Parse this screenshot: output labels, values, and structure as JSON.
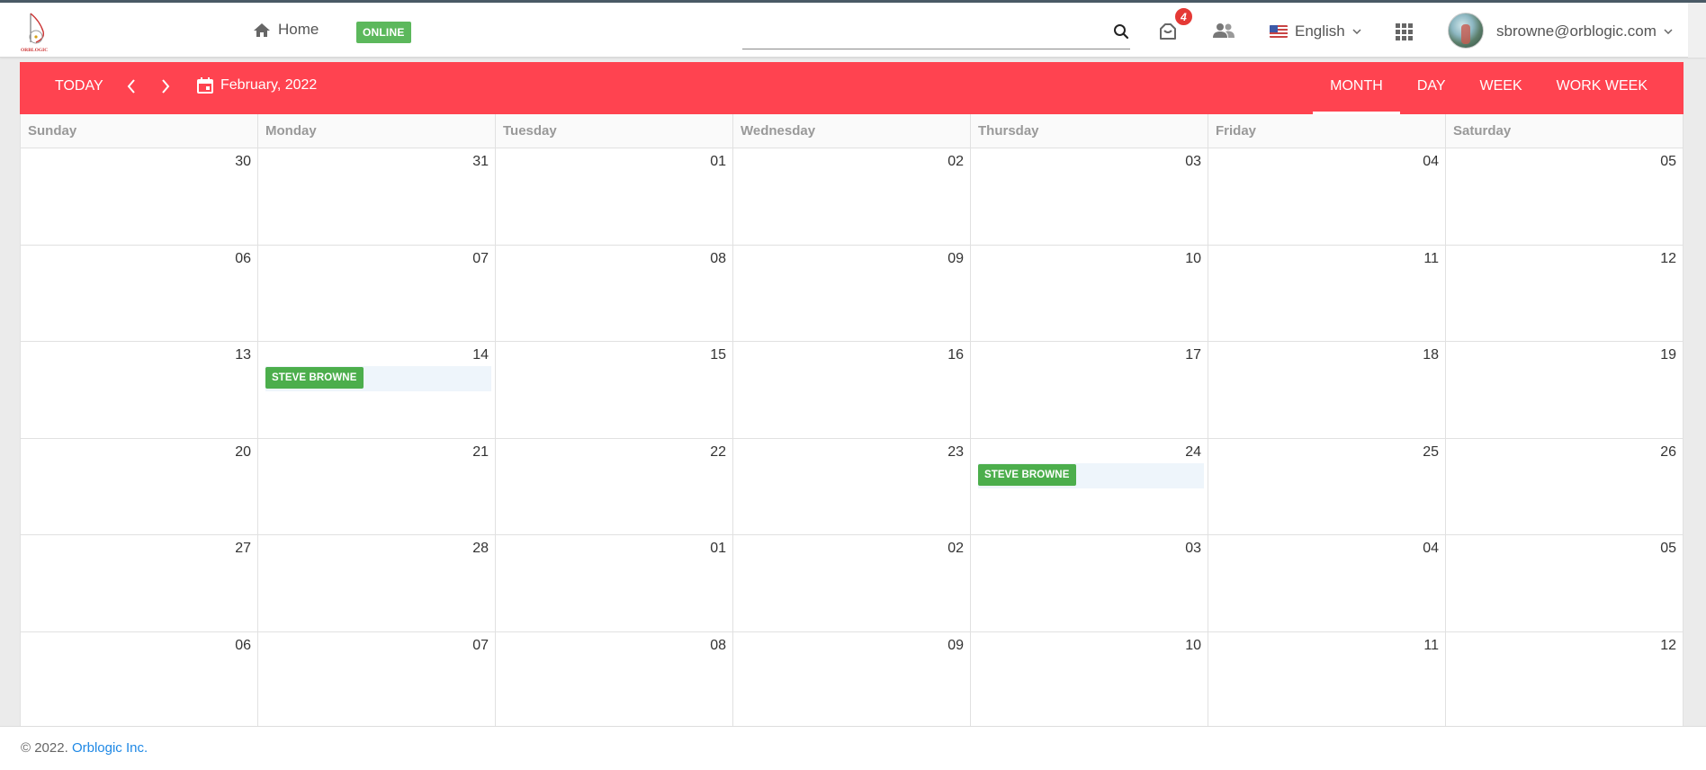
{
  "header": {
    "logo_text": "ORBLOGIC",
    "home_label": "Home",
    "status_badge": "ONLINE",
    "search": {
      "value": "",
      "placeholder": ""
    },
    "notifications_count": "4",
    "language": "English",
    "user_email": "sbrowne@orblogic.com",
    "icons": [
      "home-icon",
      "search-icon",
      "notification-icon",
      "people-icon",
      "flag-icon",
      "chevron-down-icon",
      "apps-grid-icon",
      "avatar"
    ]
  },
  "calendar": {
    "today_label": "TODAY",
    "current_period": "February, 2022",
    "views": [
      "MONTH",
      "DAY",
      "WEEK",
      "WORK WEEK"
    ],
    "active_view": "MONTH",
    "weekdays": [
      "Sunday",
      "Monday",
      "Tuesday",
      "Wednesday",
      "Thursday",
      "Friday",
      "Saturday"
    ],
    "days": [
      "30",
      "31",
      "01",
      "02",
      "03",
      "04",
      "05",
      "06",
      "07",
      "08",
      "09",
      "10",
      "11",
      "12",
      "13",
      "14",
      "15",
      "16",
      "17",
      "18",
      "19",
      "20",
      "21",
      "22",
      "23",
      "24",
      "25",
      "26",
      "27",
      "28",
      "01",
      "02",
      "03",
      "04",
      "05",
      "06",
      "07",
      "08",
      "09",
      "10",
      "11",
      "12"
    ],
    "events": [
      {
        "day_index": 15,
        "label": "STEVE BROWNE"
      },
      {
        "day_index": 25,
        "label": "STEVE BROWNE"
      }
    ],
    "colors": {
      "toolbar": "#ff4350",
      "event": "#4cae4c",
      "online_badge": "#5cb85c",
      "notification_badge": "#e53935"
    }
  },
  "footer": {
    "copyright": "© 2022.",
    "company": "Orblogic Inc."
  }
}
